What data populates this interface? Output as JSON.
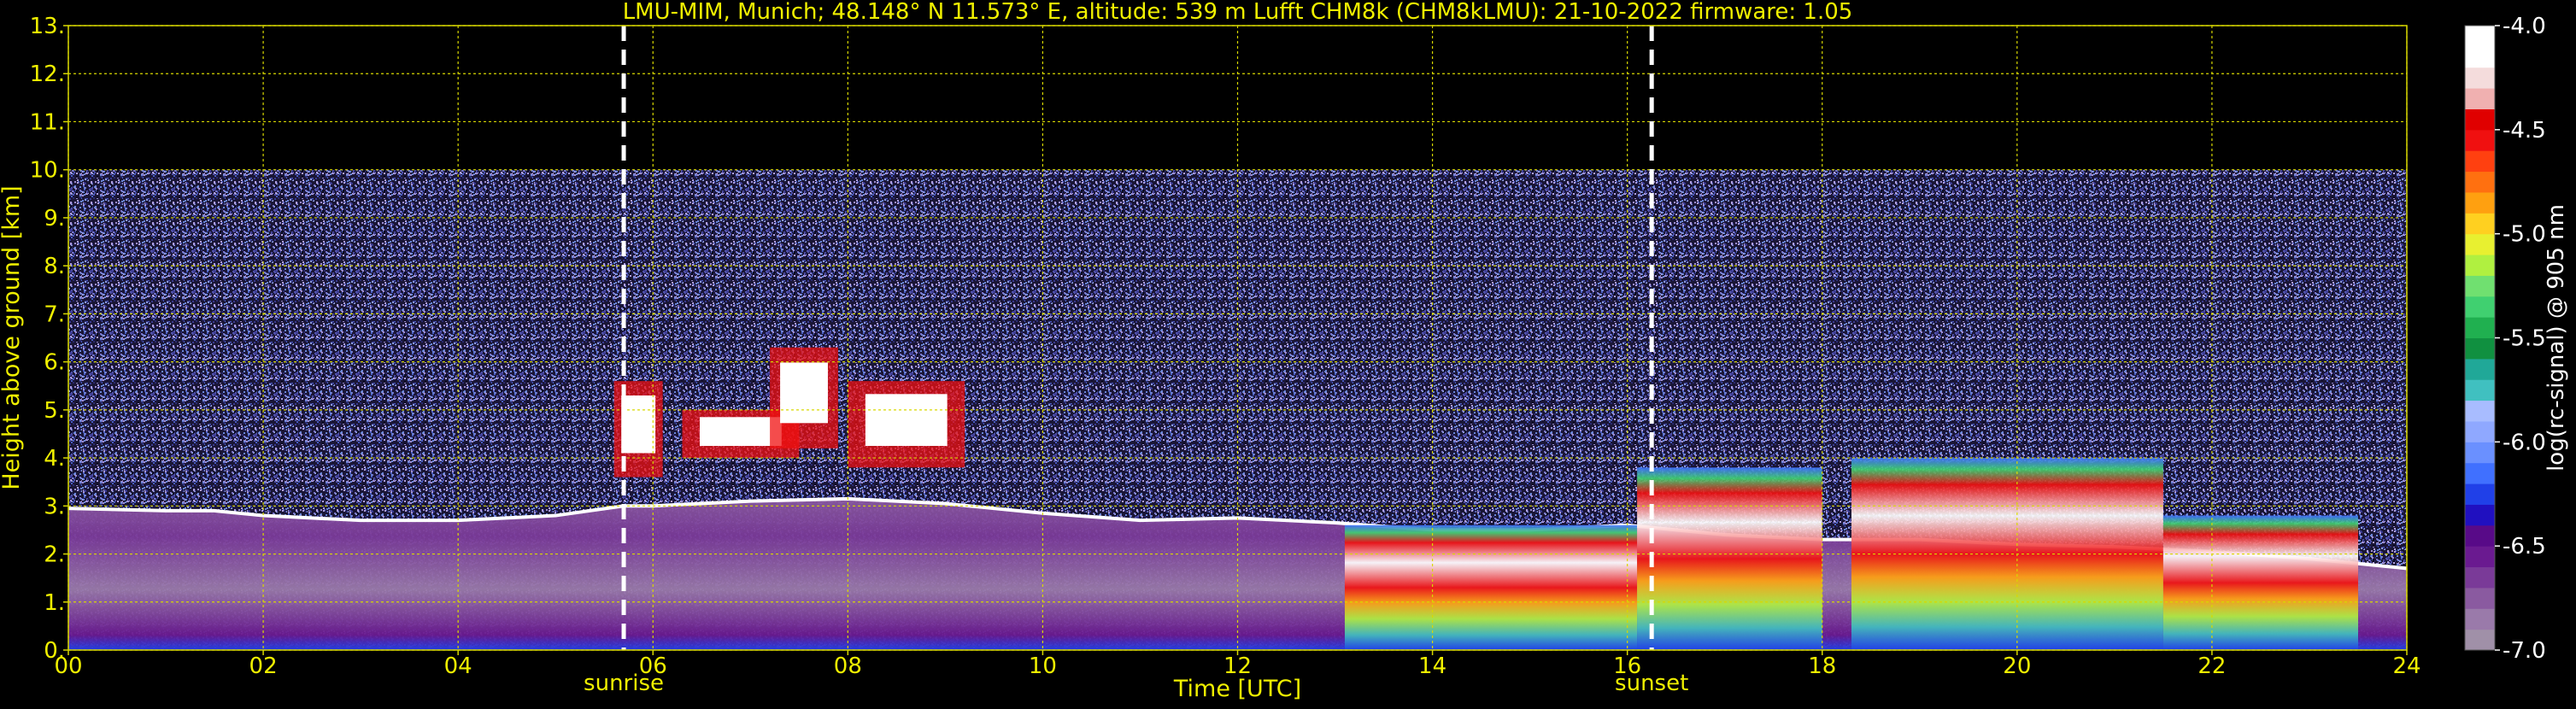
{
  "chart_data": {
    "type": "heatmap",
    "title": "LMU-MIM, Munich; 48.148° N 11.573° E, altitude: 539 m    Lufft CHM8k (CHM8kLMU): 21-10-2022    firmware: 1.05",
    "xlabel": "Time [UTC]",
    "ylabel": "Height above ground [km]",
    "xlim": [
      0,
      24
    ],
    "ylim": [
      0,
      13
    ],
    "x_ticks": [
      0,
      2,
      4,
      6,
      8,
      10,
      12,
      14,
      16,
      18,
      20,
      22,
      24
    ],
    "x_tick_labels": [
      "00",
      "02",
      "04",
      "06",
      "08",
      "10",
      "12",
      "14",
      "16",
      "18",
      "20",
      "22",
      "24"
    ],
    "y_ticks": [
      0,
      1,
      2,
      3,
      4,
      5,
      6,
      7,
      8,
      9,
      10,
      11,
      12,
      13
    ],
    "y_tick_labels": [
      "0.",
      "1.",
      "2.",
      "3.",
      "4.",
      "5.",
      "6.",
      "7.",
      "8.",
      "9.",
      "10.",
      "11.",
      "12.",
      "13."
    ],
    "grid": true,
    "data_top_km": 10,
    "markers": [
      {
        "label": "sunrise",
        "time": 5.7
      },
      {
        "label": "sunset",
        "time": 16.25
      }
    ],
    "colorbar": {
      "label": "log(rc-signal) @ 905 nm",
      "vmin": -7.0,
      "vmax": -4.0,
      "ticks": [
        -4.0,
        -4.5,
        -5.0,
        -5.5,
        -6.0,
        -6.5,
        -7.0
      ],
      "tick_labels": [
        "-4.0",
        "-4.5",
        "-5.0",
        "-5.5",
        "-6.0",
        "-6.5",
        "-7.0"
      ],
      "colors": [
        "#a090a8",
        "#9a7aaa",
        "#8a5aa0",
        "#7a3a98",
        "#6a1a90",
        "#580a88",
        "#2010c0",
        "#2040e8",
        "#4070ff",
        "#6a90ff",
        "#8fa8ff",
        "#a8bcff",
        "#40c0c0",
        "#20a898",
        "#109040",
        "#20b050",
        "#40d070",
        "#70e070",
        "#b0f040",
        "#e8f030",
        "#ffd020",
        "#ffa010",
        "#ff7010",
        "#ff4010",
        "#f01010",
        "#e00000",
        "#f0b0b0",
        "#f4dcdc",
        "#ffffff",
        "#ffffff"
      ]
    },
    "features": {
      "aerosol_layer_top_km": [
        [
          0.0,
          2.95
        ],
        [
          1.0,
          2.9
        ],
        [
          1.5,
          2.9
        ],
        [
          2.0,
          2.8
        ],
        [
          3.0,
          2.7
        ],
        [
          4.0,
          2.7
        ],
        [
          5.0,
          2.8
        ],
        [
          5.7,
          3.0
        ],
        [
          6.0,
          3.0
        ],
        [
          7.0,
          3.1
        ],
        [
          8.0,
          3.15
        ],
        [
          9.0,
          3.05
        ],
        [
          10.0,
          2.85
        ],
        [
          11.0,
          2.7
        ],
        [
          12.0,
          2.75
        ],
        [
          13.0,
          2.65
        ],
        [
          14.0,
          2.5
        ],
        [
          15.0,
          2.5
        ],
        [
          16.0,
          2.6
        ],
        [
          17.0,
          2.4
        ],
        [
          18.0,
          2.3
        ],
        [
          19.0,
          2.3
        ],
        [
          20.0,
          2.2
        ],
        [
          21.0,
          2.15
        ],
        [
          22.0,
          2.05
        ],
        [
          23.0,
          1.9
        ],
        [
          24.0,
          1.7
        ]
      ],
      "strong_clouds": [
        {
          "t0": 13.1,
          "t1": 16.1,
          "h0": 0.0,
          "h1": 2.6
        },
        {
          "t0": 16.1,
          "t1": 18.0,
          "h0": 0.0,
          "h1": 3.8
        },
        {
          "t0": 18.3,
          "t1": 21.5,
          "h0": 0.0,
          "h1": 4.0
        },
        {
          "t0": 21.5,
          "t1": 23.5,
          "h0": 0.0,
          "h1": 2.8
        }
      ],
      "mid_level_clouds": [
        {
          "t0": 5.6,
          "t1": 6.1,
          "h0": 3.6,
          "h1": 5.6
        },
        {
          "t0": 6.3,
          "t1": 7.5,
          "h0": 4.0,
          "h1": 5.0
        },
        {
          "t0": 7.2,
          "t1": 7.9,
          "h0": 4.2,
          "h1": 6.3
        },
        {
          "t0": 8.0,
          "t1": 9.2,
          "h0": 3.8,
          "h1": 5.6
        }
      ]
    }
  }
}
